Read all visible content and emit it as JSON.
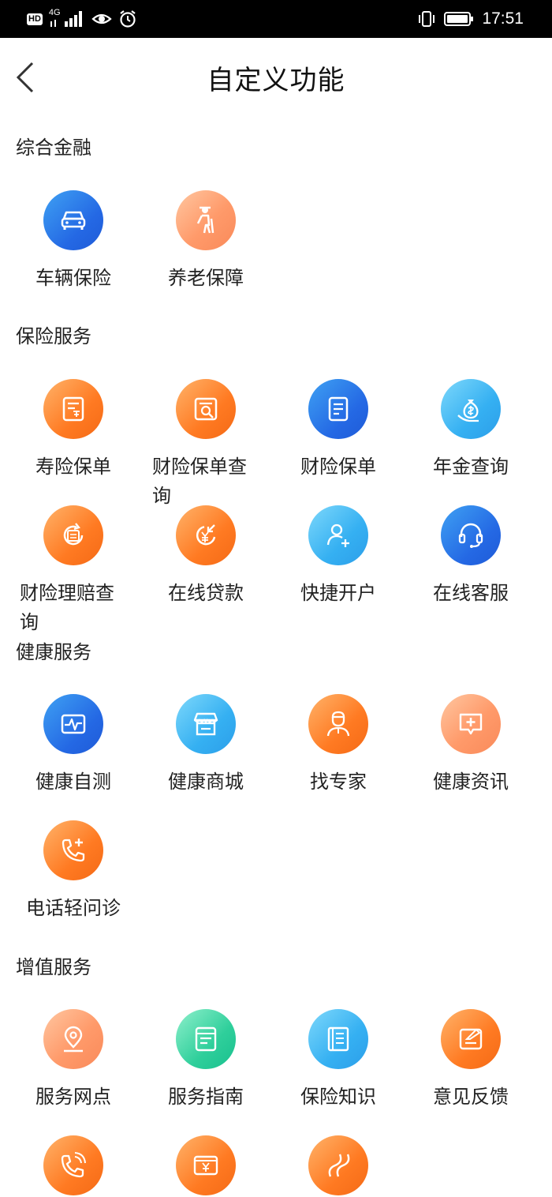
{
  "status_bar": {
    "hd_label": "HD",
    "network_label": "4G",
    "time": "17:51",
    "left_icons": [
      "hd-icon",
      "signal-icon",
      "eye-icon",
      "alarm-icon"
    ],
    "right_icons": [
      "vibrate-icon",
      "battery-icon"
    ]
  },
  "header": {
    "back_icon": "chevron-left-icon",
    "title": "自定义功能"
  },
  "sections": [
    {
      "title": "综合金融",
      "items": [
        {
          "label": "车辆保险",
          "icon": "car-icon"
        },
        {
          "label": "养老保障",
          "icon": "elderly-icon"
        }
      ]
    },
    {
      "title": "保险服务",
      "items": [
        {
          "label": "寿险保单",
          "icon": "life-policy-icon"
        },
        {
          "label": "财险保单查询",
          "icon": "policy-search-icon"
        },
        {
          "label": "财险保单",
          "icon": "document-icon"
        },
        {
          "label": "年金查询",
          "icon": "money-bag-icon"
        },
        {
          "label": "财险理赔查询",
          "icon": "claim-icon"
        },
        {
          "label": "在线贷款",
          "icon": "yuan-loan-icon"
        },
        {
          "label": "快捷开户",
          "icon": "add-user-icon"
        },
        {
          "label": "在线客服",
          "icon": "headset-icon"
        }
      ]
    },
    {
      "title": "健康服务",
      "items": [
        {
          "label": "健康自测",
          "icon": "heartbeat-icon"
        },
        {
          "label": "健康商城",
          "icon": "store-icon"
        },
        {
          "label": "找专家",
          "icon": "doctor-icon"
        },
        {
          "label": "健康资讯",
          "icon": "medical-chat-icon"
        },
        {
          "label": "电话轻问诊",
          "icon": "phone-plus-icon"
        }
      ]
    },
    {
      "title": "增值服务",
      "items": [
        {
          "label": "服务网点",
          "icon": "location-icon"
        },
        {
          "label": "服务指南",
          "icon": "guide-icon"
        },
        {
          "label": "保险知识",
          "icon": "book-icon"
        },
        {
          "label": "意见反馈",
          "icon": "feedback-icon"
        },
        {
          "label": "",
          "icon": "phone-call-icon"
        },
        {
          "label": "",
          "icon": "yuan-card-icon"
        },
        {
          "label": "",
          "icon": "road-icon"
        }
      ]
    }
  ],
  "colors": {
    "orange": "#ff7a22",
    "blue": "#2468e4",
    "sky": "#35b0f2",
    "peach": "#ff9a6a",
    "teal": "#2fcf9b"
  }
}
